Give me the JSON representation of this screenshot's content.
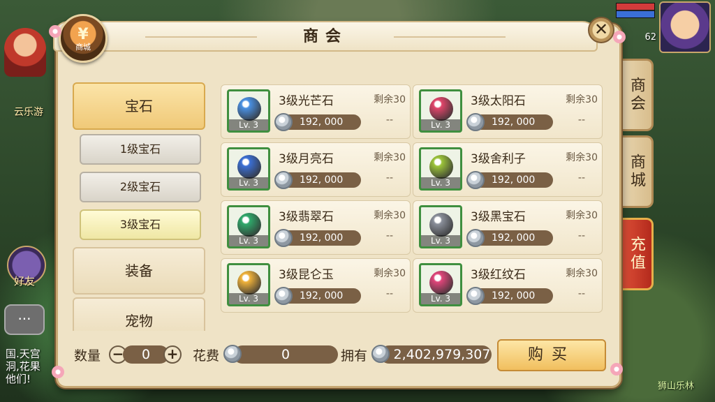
{
  "scene": {
    "left_name": "云乐游",
    "level": "62",
    "friend_label": "好友",
    "chat_line1": "国.天宫",
    "chat_line2": "洞,花果",
    "chat_line3": "他们!",
    "map_name": "狮山乐林"
  },
  "window": {
    "title": "商会",
    "badge_symbol": "¥",
    "badge_label": "商城",
    "close_symbol": "✕"
  },
  "side_tabs": [
    {
      "label": "商会"
    },
    {
      "label": "商城"
    },
    {
      "label": "充值"
    }
  ],
  "categories": {
    "main0": "宝石",
    "sub": [
      "1级宝石",
      "2级宝石",
      "3级宝石"
    ],
    "main1": "装备",
    "main2": "宠物"
  },
  "items": [
    {
      "name": "3级光芒石",
      "remain": "剩余30",
      "price": "192, 000",
      "lv": "Lv. 3",
      "dash": "--",
      "color": "#4a90e2"
    },
    {
      "name": "3级太阳石",
      "remain": "剩余30",
      "price": "192, 000",
      "lv": "Lv. 3",
      "dash": "--",
      "color": "#e0456a"
    },
    {
      "name": "3级月亮石",
      "remain": "剩余30",
      "price": "192, 000",
      "lv": "Lv. 3",
      "dash": "--",
      "color": "#3b6fd4"
    },
    {
      "name": "3级舍利子",
      "remain": "剩余30",
      "price": "192, 000",
      "lv": "Lv. 3",
      "dash": "--",
      "color": "#9cc43a"
    },
    {
      "name": "3级翡翠石",
      "remain": "剩余30",
      "price": "192, 000",
      "lv": "Lv. 3",
      "dash": "--",
      "color": "#2fa86a"
    },
    {
      "name": "3级黑宝石",
      "remain": "剩余30",
      "price": "192, 000",
      "lv": "Lv. 3",
      "dash": "--",
      "color": "#8a8f9a"
    },
    {
      "name": "3级昆仑玉",
      "remain": "剩余30",
      "price": "192, 000",
      "lv": "Lv. 3",
      "dash": "--",
      "color": "#f0b23a"
    },
    {
      "name": "3级红纹石",
      "remain": "剩余30",
      "price": "192, 000",
      "lv": "Lv. 3",
      "dash": "--",
      "color": "#e0457a"
    }
  ],
  "bottom": {
    "qty_label": "数量",
    "qty_value": "0",
    "minus": "−",
    "plus": "+",
    "cost_label": "花费",
    "cost_value": "0",
    "own_label": "拥有",
    "own_value": "2,402,979,307",
    "buy_label": "购买"
  }
}
